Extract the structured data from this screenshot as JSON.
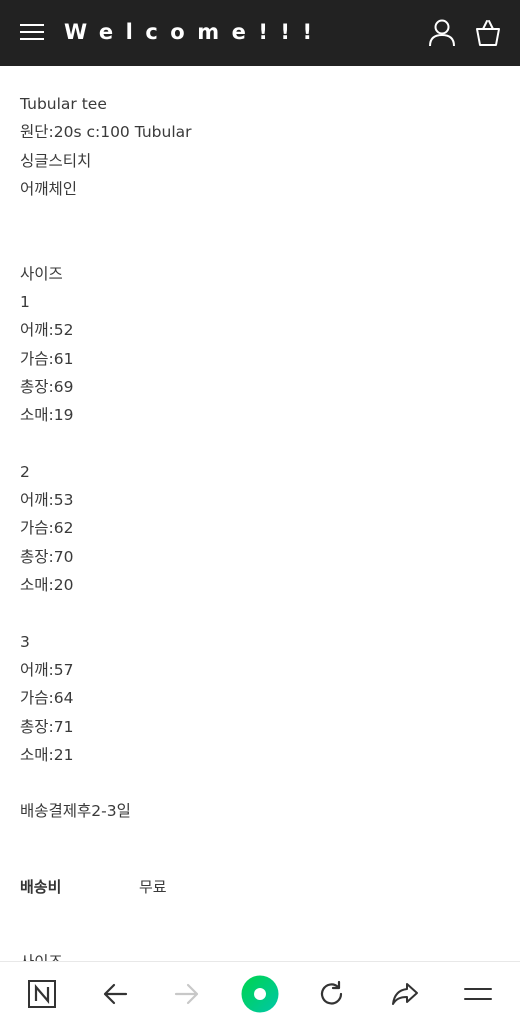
{
  "header": {
    "title": "Welcome!!!",
    "icons": [
      "menu-icon",
      "user-icon",
      "shopping-bag-icon"
    ]
  },
  "description": {
    "intro": [
      "Tubular tee",
      "원단:20s c:100 Tubular",
      "싱글스티치",
      "어깨체인"
    ],
    "size_heading": "사이즈",
    "sizes": [
      {
        "label": "1",
        "shoulder": "어깨:52",
        "chest": "가슴:61",
        "length": "총장:69",
        "sleeve": "소매:19"
      },
      {
        "label": "2",
        "shoulder": "어깨:53",
        "chest": "가슴:62",
        "length": "총장:70",
        "sleeve": "소매:20"
      },
      {
        "label": "3",
        "shoulder": "어깨:57",
        "chest": "가슴:64",
        "length": "총장:71",
        "sleeve": "소매:21"
      }
    ],
    "delivery_note": "배송결제후2-3일"
  },
  "shipping": {
    "label": "배송비",
    "value": "무료"
  },
  "next_section_heading": "사이즈",
  "browser_toolbar": {
    "icons": [
      "naver-home-icon",
      "back-arrow-icon",
      "forward-arrow-icon",
      "green-dot-icon",
      "reload-icon",
      "share-icon",
      "menu-icon"
    ],
    "colors": {
      "accent_green": "#03c75a",
      "disabled": "#c8c8c8",
      "icon": "#333333"
    }
  },
  "colors": {
    "header_bg": "#222222",
    "text": "#3a3a3a"
  }
}
